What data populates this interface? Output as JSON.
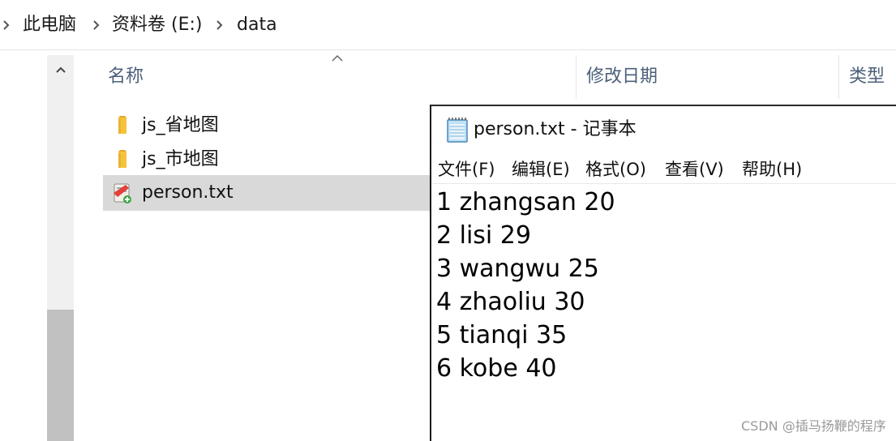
{
  "breadcrumb": {
    "items": [
      "此电脑",
      "资料卷 (E:)",
      "data"
    ]
  },
  "file_list": {
    "columns": {
      "name": "名称",
      "date_modified": "修改日期",
      "type": "类型"
    },
    "sort_indicator_icon": "sort-ascending-caret",
    "items": [
      {
        "name": "js_省地图",
        "icon": "folder-icon",
        "selected": false
      },
      {
        "name": "js_市地图",
        "icon": "folder-icon",
        "selected": false
      },
      {
        "name": "person.txt",
        "icon": "text-file-icon",
        "selected": true
      }
    ]
  },
  "notepad": {
    "title": "person.txt - 记事本",
    "menu": [
      "文件(F)",
      "编辑(E)",
      "格式(O)",
      "查看(V)",
      "帮助(H)"
    ],
    "lines": [
      "1 zhangsan 20",
      "2 lisi 29",
      "3 wangwu 25",
      "4 zhaoliu 30",
      "5 tianqi 35",
      "6 kobe 40"
    ]
  },
  "watermark": "CSDN @插马扬鞭的程序"
}
